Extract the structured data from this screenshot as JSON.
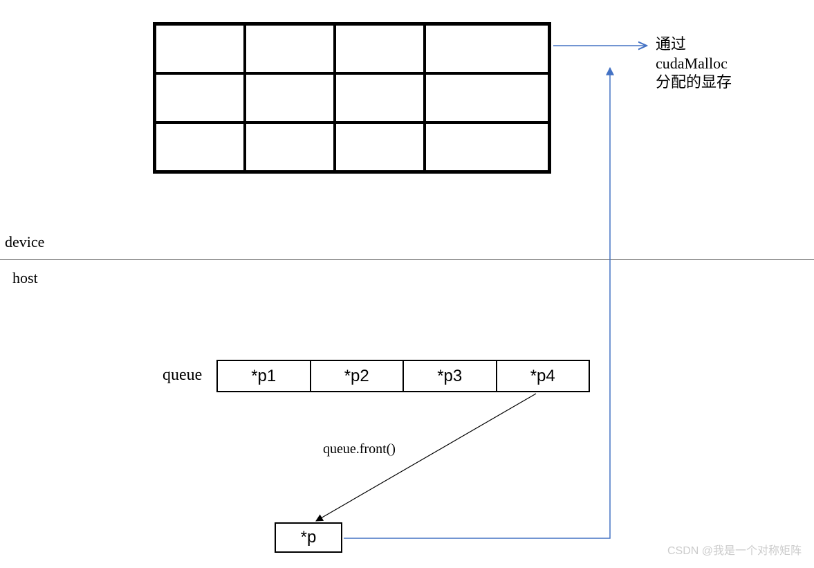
{
  "labels": {
    "device": "device",
    "host": "host",
    "queue": "queue",
    "queue_front": "queue.front()",
    "p": "*p"
  },
  "annotation": {
    "line1": "通过",
    "line2": "cudaMalloc",
    "line3": "分配的显存"
  },
  "queue_items": [
    "*p1",
    "*p2",
    "*p3",
    "*p4"
  ],
  "grid": {
    "rows": 3,
    "cols": 4
  },
  "watermark": "CSDN @我是一个对称矩阵",
  "chart_data": {
    "type": "table",
    "description": "Memory-pool diagram: device-side 3×4 block of GPU memory allocated via cudaMalloc; host-side queue of pointers (*p1..*p4). queue.front() yields *p which points back to the device memory block.",
    "device_grid": {
      "rows": 3,
      "cols": 4
    },
    "host_queue": [
      "*p1",
      "*p2",
      "*p3",
      "*p4"
    ],
    "dequeued_pointer": "*p",
    "annotation_zh": "通过 cudaMalloc 分配的显存",
    "arrows": [
      {
        "from": "device_grid.top_right",
        "to": "annotation",
        "style": "blue"
      },
      {
        "from": "queue.right_edge",
        "to": "*p",
        "label": "queue.front()",
        "style": "black"
      },
      {
        "from": "*p",
        "to": "device_grid",
        "style": "blue"
      }
    ]
  }
}
